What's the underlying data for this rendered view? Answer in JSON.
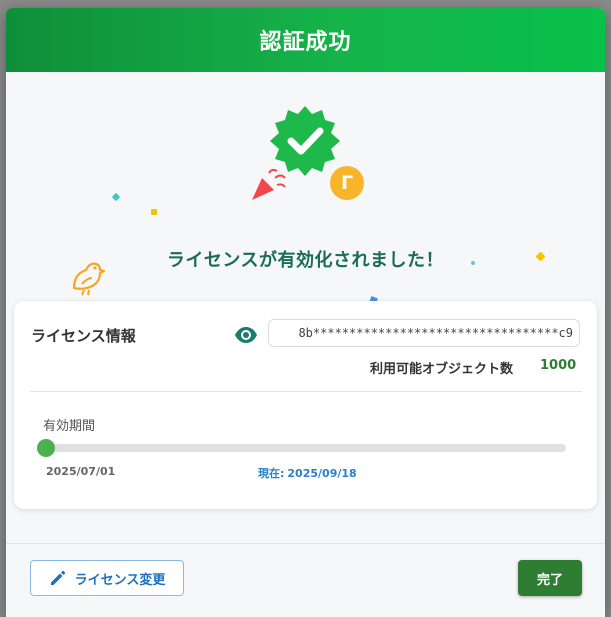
{
  "dialog": {
    "title": "認証成功",
    "success_message": "ライセンスが有効化されました！",
    "coin_glyph": "Г"
  },
  "license": {
    "section_title": "ライセンス情報",
    "key_masked": "8b**********************************c9",
    "object_count_label": "利用可能オブジェクト数",
    "object_count_value": "1000"
  },
  "validity": {
    "label": "有効期間",
    "start_date": "2025/07/01",
    "current_prefix": "現在:",
    "current_date": "2025/09/18",
    "progress": 0
  },
  "footer": {
    "change_button_label": "ライセンス変更",
    "done_button_label": "完了"
  },
  "colors": {
    "header_gradient_start": "#0f8e3a",
    "header_gradient_end": "#08c04a",
    "badge": "#1fb84a",
    "primary_button": "#2e7d32",
    "accent_blue": "#2a7fc9"
  },
  "icons": {
    "badge": "check-badge-icon",
    "coin": "coin-icon",
    "popper": "party-popper-icon",
    "bird": "bird-icon",
    "visibility": "eye-icon",
    "edit": "pencil-icon"
  }
}
